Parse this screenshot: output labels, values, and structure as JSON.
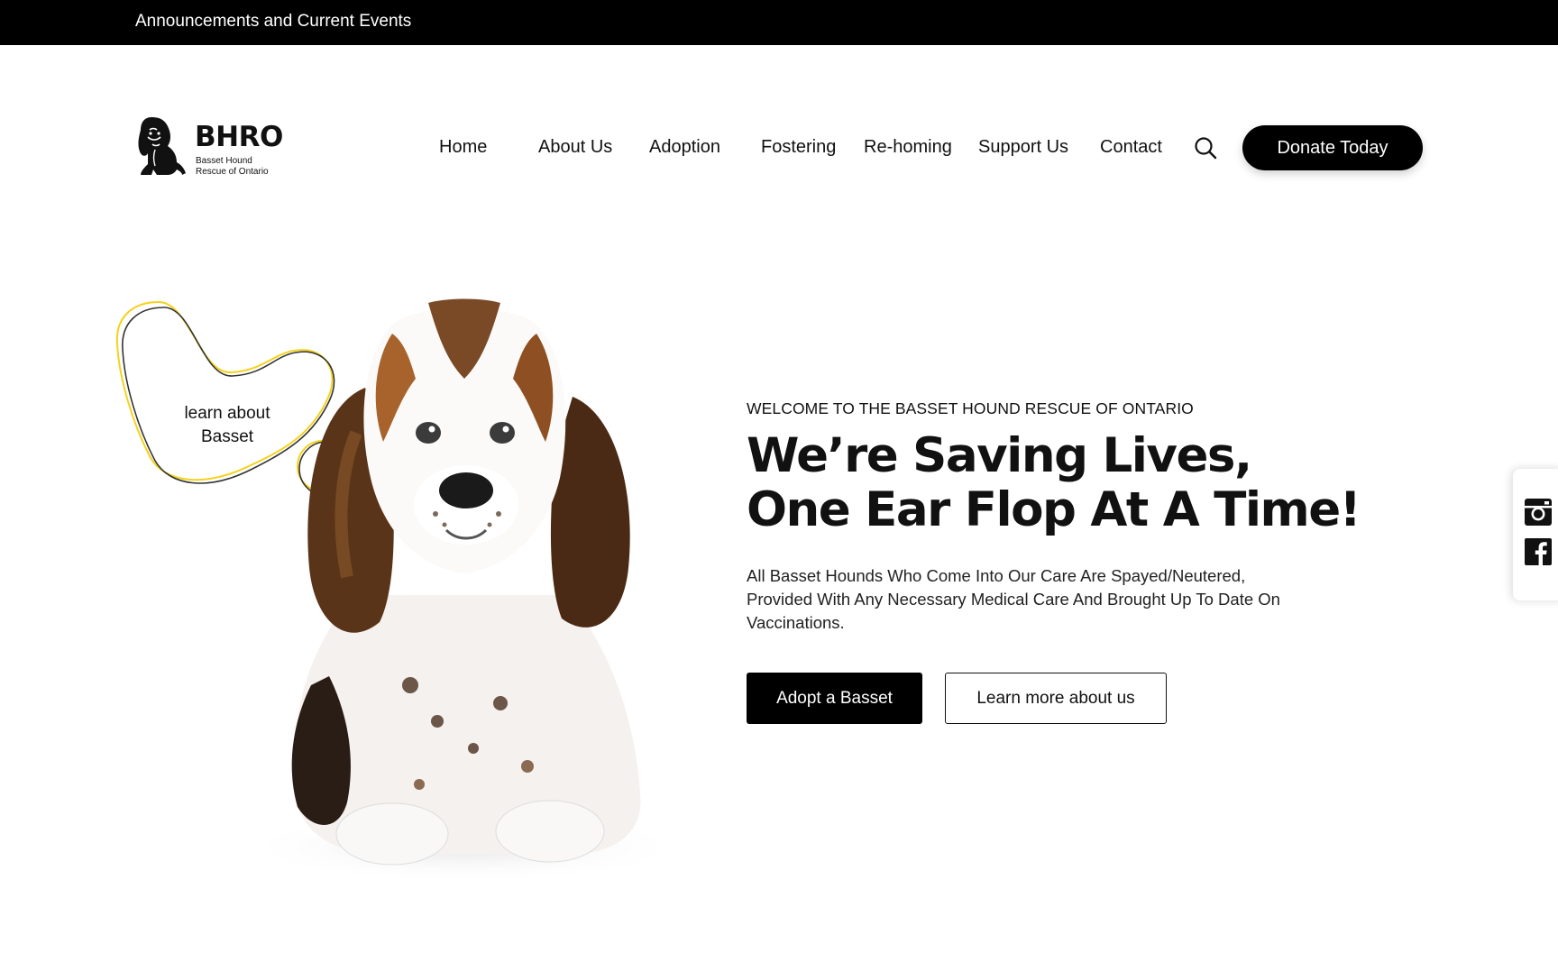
{
  "announcement": {
    "text": "Announcements and Current Events"
  },
  "logo": {
    "title": "BHRO",
    "subtitle_line1": "Basset Hound",
    "subtitle_line2": "Rescue of Ontario",
    "icon": "basset-hound-silhouette-icon"
  },
  "nav": {
    "items": [
      {
        "label": "Home"
      },
      {
        "label": "About Us"
      },
      {
        "label": "Adoption"
      },
      {
        "label": "Fostering"
      },
      {
        "label": "Re-homing"
      },
      {
        "label": "Support Us"
      },
      {
        "label": "Contact"
      }
    ],
    "search_icon": "search-icon",
    "donate_label": "Donate Today"
  },
  "hero": {
    "blob_label_line1": "learn about",
    "blob_label_line2": "Basset",
    "eyebrow": "WELCOME TO THE BASSET HOUND RESCUE OF ONTARIO",
    "headline_line1": "We’re Saving Lives,",
    "headline_line2": "One Ear Flop At A Time!",
    "description": "All Basset Hounds Who Come Into Our Care Are Spayed/Neutered, Provided With Any Necessary Medical Care And Brought Up To Date On Vaccinations.",
    "primary_cta": "Adopt a Basset",
    "secondary_cta": "Learn more about us",
    "image_subject": "basset-hound-puppy"
  },
  "social": {
    "icons": [
      "instagram-icon",
      "facebook-icon"
    ]
  },
  "colors": {
    "bar_bg": "#000000",
    "accent_yellow": "#f5d21b",
    "text": "#111111",
    "button_bg": "#000000",
    "page_bg": "#ffffff"
  }
}
